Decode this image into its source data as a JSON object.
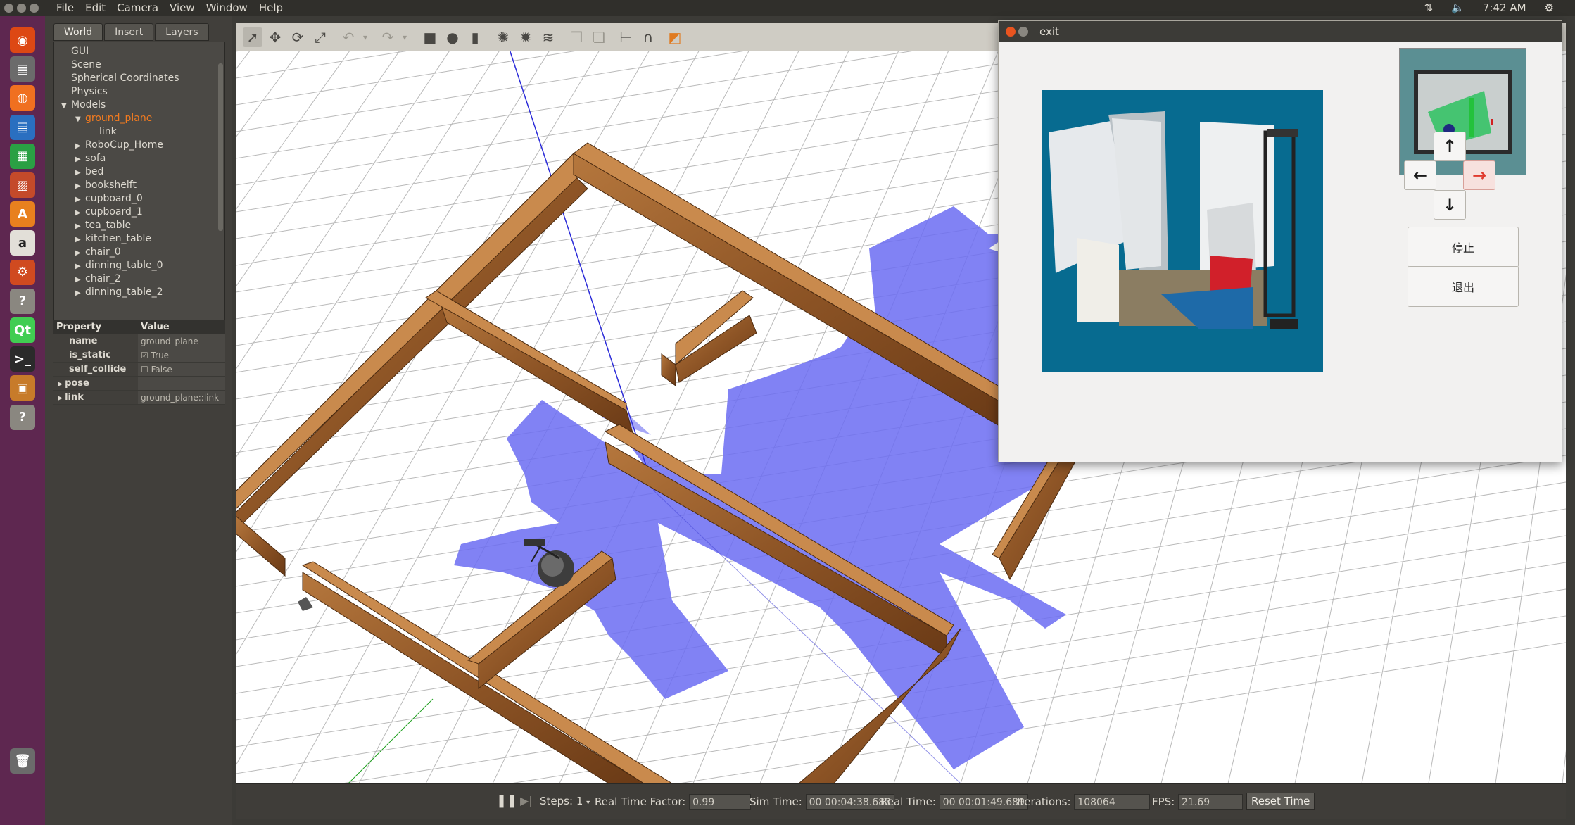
{
  "topbar": {
    "menu": [
      "File",
      "Edit",
      "Camera",
      "View",
      "Window",
      "Help"
    ],
    "time": "7:42 AM"
  },
  "launcher": {
    "icons": [
      "ubuntu-icon",
      "files-icon",
      "firefox-icon",
      "writer-icon",
      "calc-icon",
      "impress-icon",
      "software-center-icon",
      "amazon-icon",
      "settings-icon",
      "help-icon",
      "qt-creator-icon",
      "terminal-icon",
      "gazebo-icon",
      "unknown-app-icon",
      "trash-icon"
    ]
  },
  "left_panel": {
    "tabs": [
      "World",
      "Insert",
      "Layers"
    ],
    "tree": [
      {
        "label": "GUI",
        "level": 0,
        "arrow": ""
      },
      {
        "label": "Scene",
        "level": 0,
        "arrow": ""
      },
      {
        "label": "Spherical Coordinates",
        "level": 0,
        "arrow": ""
      },
      {
        "label": "Physics",
        "level": 0,
        "arrow": ""
      },
      {
        "label": "Models",
        "level": 0,
        "arrow": "down"
      },
      {
        "label": "ground_plane",
        "level": 1,
        "arrow": "down",
        "selected": true
      },
      {
        "label": "link",
        "level": 2,
        "arrow": ""
      },
      {
        "label": "RoboCup_Home",
        "level": 1,
        "arrow": "right"
      },
      {
        "label": "sofa",
        "level": 1,
        "arrow": "right"
      },
      {
        "label": "bed",
        "level": 1,
        "arrow": "right"
      },
      {
        "label": "bookshelft",
        "level": 1,
        "arrow": "right"
      },
      {
        "label": "cupboard_0",
        "level": 1,
        "arrow": "right"
      },
      {
        "label": "cupboard_1",
        "level": 1,
        "arrow": "right"
      },
      {
        "label": "tea_table",
        "level": 1,
        "arrow": "right"
      },
      {
        "label": "kitchen_table",
        "level": 1,
        "arrow": "right"
      },
      {
        "label": "chair_0",
        "level": 1,
        "arrow": "right"
      },
      {
        "label": "dinning_table_0",
        "level": 1,
        "arrow": "right"
      },
      {
        "label": "chair_2",
        "level": 1,
        "arrow": "right"
      },
      {
        "label": "dinning_table_2",
        "level": 1,
        "arrow": "right"
      }
    ],
    "props_header": {
      "property": "Property",
      "value": "Value"
    },
    "props": [
      {
        "key": "name",
        "value": "ground_plane",
        "checkbox": false
      },
      {
        "key": "is_static",
        "value": "True",
        "checkbox": true
      },
      {
        "key": "self_collide",
        "value": "False",
        "checkbox": true
      },
      {
        "key": "pose",
        "value": "",
        "checkbox": false,
        "expandable": true
      },
      {
        "key": "link",
        "value": "ground_plane::link",
        "checkbox": false,
        "expandable": true
      }
    ]
  },
  "bottom_bar": {
    "steps_label": "Steps:",
    "steps_value": "1",
    "rtf_label": "Real Time Factor:",
    "rtf_value": "0.99",
    "sim_label": "Sim Time:",
    "sim_value": "00 00:04:38.683",
    "real_label": "Real Time:",
    "real_value": "00 00:01:49.689",
    "iter_label": "Iterations:",
    "iter_value": "108064",
    "fps_label": "FPS:",
    "fps_value": "21.69",
    "reset_label": "Reset Time"
  },
  "dialog": {
    "title": "exit",
    "stop_label": "停止",
    "exit_label": "退出",
    "up": "↑",
    "down": "↓",
    "left": "←",
    "right": "→",
    "right_color": "#e03a2e"
  }
}
